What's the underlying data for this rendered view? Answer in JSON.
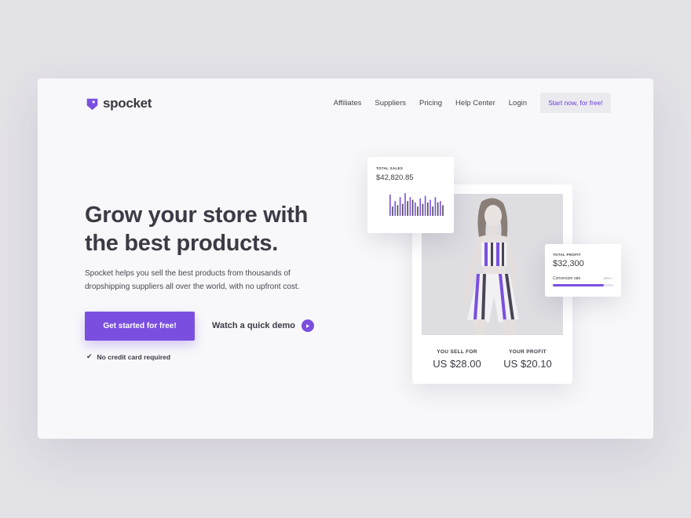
{
  "brand": {
    "name": "spocket",
    "color": "#7a4fe0"
  },
  "nav": {
    "links": [
      "Affiliates",
      "Suppliers",
      "Pricing",
      "Help Center",
      "Login"
    ],
    "cta": "Start now, for free!"
  },
  "hero": {
    "title": "Grow your store with the best products.",
    "subtitle": "Spocket helps you sell the best products from thousands of dropshipping suppliers all over the world, with no upfront cost.",
    "primary_cta": "Get started for free!",
    "demo_link": "Watch a quick demo",
    "note": "No credit card required"
  },
  "sales_card": {
    "label": "TOTAL SALES",
    "value": "$42,820.85",
    "bars": [
      0.8,
      0.35,
      0.55,
      0.4,
      0.7,
      0.45,
      0.85,
      0.55,
      0.7,
      0.6,
      0.5,
      0.35,
      0.65,
      0.45,
      0.75,
      0.5,
      0.6,
      0.35,
      0.7,
      0.5,
      0.55,
      0.4
    ]
  },
  "product_card": {
    "sell_label": "YOU SELL FOR",
    "sell_value": "US $28.00",
    "profit_label": "YOUR PROFIT",
    "profit_value": "US $20.10"
  },
  "profit_card": {
    "label": "TOTAL PROFIT",
    "value": "$32,300",
    "conversion_label": "Conversion rate",
    "conversion_value": "24% ↑",
    "conversion_fraction": 0.85
  }
}
